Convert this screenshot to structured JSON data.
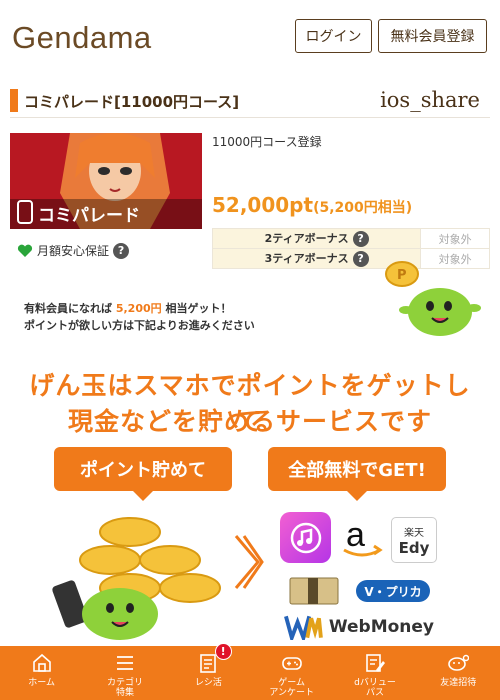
{
  "header": {
    "logo": "Gendama",
    "login_label": "ログイン",
    "register_label": "無料会員登録"
  },
  "title": {
    "text": "コミパレード[11000円コース]",
    "share": "ios_share"
  },
  "offer": {
    "thumbnail_text": "コミパレード",
    "course": "11000円コース登録",
    "points_main": "52,000pt",
    "points_equiv": "(5,200円相当)",
    "monthly_guarantee": "月額安心保証",
    "tiers": [
      {
        "label": "2ティアボーナス",
        "value": "対象外"
      },
      {
        "label": "3ティアボーナス",
        "value": "対象外"
      }
    ],
    "paid_note_prefix": "有料会員になれば",
    "paid_note_amount": "5,200円",
    "paid_note_suffix": "相当ゲット！",
    "paid_note_line2": "ポイントが欲しい方は下記よりお進みください"
  },
  "promo": {
    "line1": "げん玉はスマホでポイントをゲットして",
    "line2": "現金などを貯めるサービスです",
    "pill_left": "ポイント貯めて",
    "pill_right": "全部無料でGET!",
    "edy_top": "楽天",
    "edy_bottom": "Edy",
    "vpre": "V・プリカ",
    "webmoney": "WebMoney"
  },
  "nav": {
    "items": [
      {
        "label": "ホーム",
        "icon": "home-icon"
      },
      {
        "label": "カテゴリ\n特集",
        "icon": "menu-icon"
      },
      {
        "label": "レシ活",
        "icon": "receipt-icon"
      },
      {
        "label": "ゲーム\nアンケート",
        "icon": "gamepad-icon"
      },
      {
        "label": "dバリュー\nパス",
        "icon": "edit-icon"
      },
      {
        "label": "友達招待",
        "icon": "friend-icon"
      }
    ],
    "badge": "!"
  },
  "colors": {
    "accent": "#f07a1a",
    "brown": "#6b4a25",
    "points": "#f0931e"
  }
}
